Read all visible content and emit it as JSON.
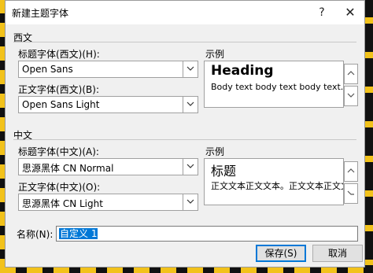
{
  "window": {
    "title": "新建主题字体",
    "help": "?",
    "close": "✕"
  },
  "western": {
    "section": "西文",
    "heading_label": "标题字体(西文)(H):",
    "heading_font": "Open Sans",
    "body_label": "正文字体(西文)(B):",
    "body_font": "Open Sans Light",
    "sample_label": "示例",
    "sample_heading": "Heading",
    "sample_body": "Body text body text body text. Body"
  },
  "chinese": {
    "section": "中文",
    "heading_label": "标题字体(中文)(A):",
    "heading_font": "思源黑体 CN Normal",
    "body_label": "正文字体(中文)(O):",
    "body_font": "思源黑体 CN Light",
    "sample_label": "示例",
    "sample_heading": "标题",
    "sample_body": "正文文本正文文本。正文文本正文文本。"
  },
  "name": {
    "label": "名称(N):",
    "value": "自定义 1"
  },
  "buttons": {
    "save": "保存(S)",
    "cancel": "取消"
  },
  "icons": {
    "dropdown": "chevron-down-icon",
    "spin_up": "chevron-up-icon",
    "spin_down": "chevron-down-icon"
  }
}
